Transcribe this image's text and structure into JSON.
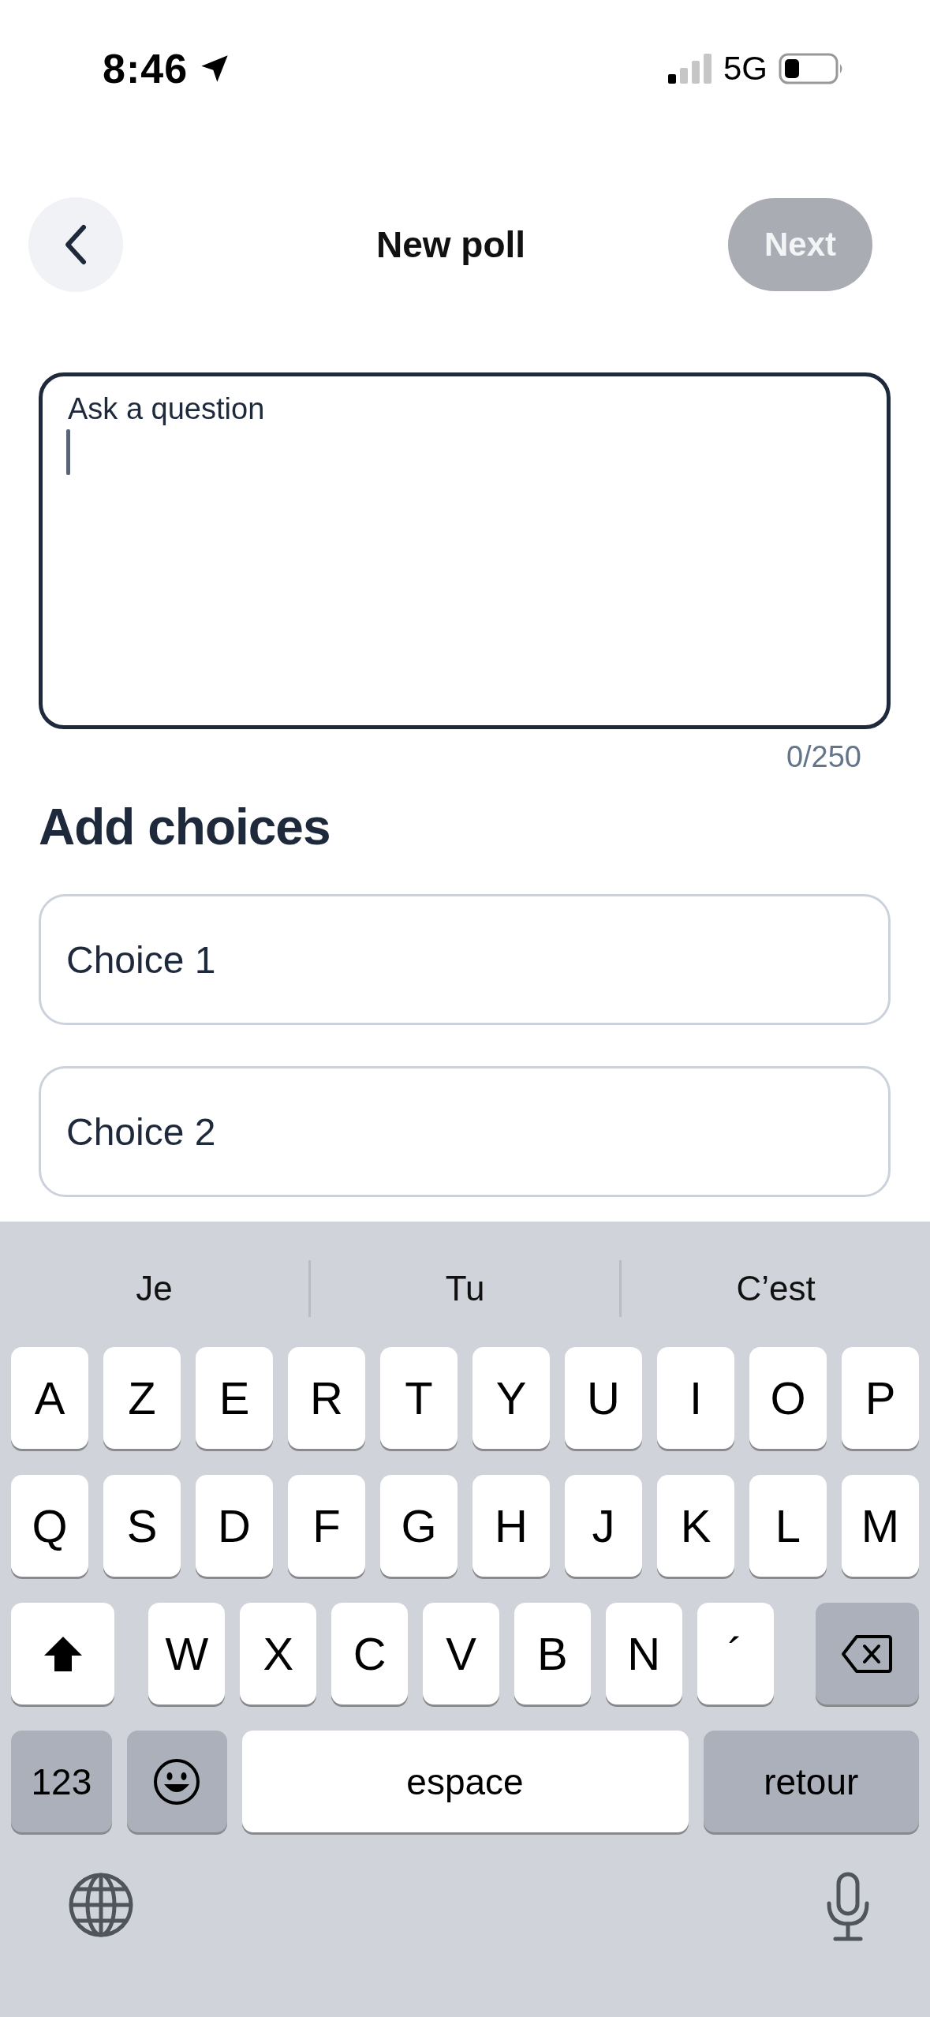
{
  "status_bar": {
    "time": "8:46",
    "network": "5G"
  },
  "nav": {
    "title": "New poll",
    "next_button": {
      "label": "Next",
      "disabled": true
    }
  },
  "question": {
    "placeholder": "Ask a question",
    "focused": true,
    "counter": "0/250"
  },
  "choices_heading": "Add choices",
  "choices": [
    {
      "placeholder": "Choice 1"
    },
    {
      "placeholder": "Choice 2"
    }
  ],
  "keyboard": {
    "suggestions": [
      "Je",
      "Tu",
      "C’est"
    ],
    "rows": [
      [
        "A",
        "Z",
        "E",
        "R",
        "T",
        "Y",
        "U",
        "I",
        "O",
        "P"
      ],
      [
        "Q",
        "S",
        "D",
        "F",
        "G",
        "H",
        "J",
        "K",
        "L",
        "M"
      ],
      [
        "W",
        "X",
        "C",
        "V",
        "B",
        "N",
        "´"
      ]
    ],
    "numbers_key": "123",
    "space_key": "espace",
    "return_key": "retour"
  }
}
